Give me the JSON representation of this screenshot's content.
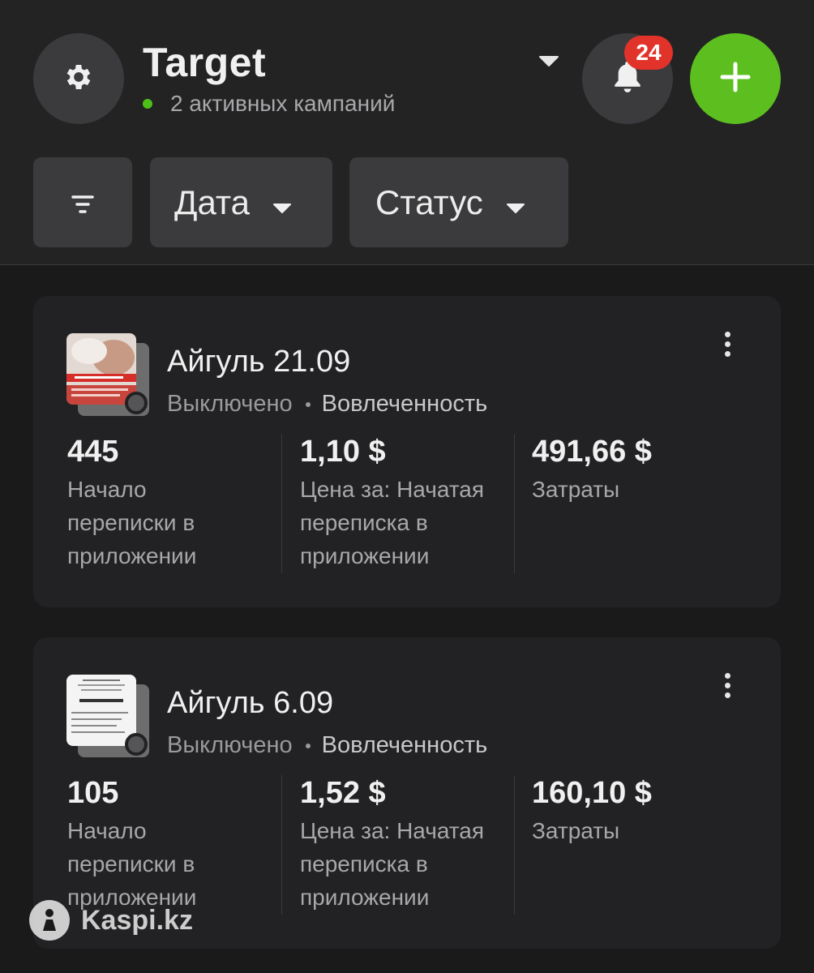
{
  "header": {
    "title": "Target",
    "subtitle": "2 активных кампаний",
    "notifications_count": "24"
  },
  "filters": {
    "date_label": "Дата",
    "status_label": "Статус"
  },
  "campaigns": [
    {
      "name": "Айгуль 21.09",
      "status": "Выключено",
      "objective": "Вовлеченность",
      "metrics": [
        {
          "value": "445",
          "label": "Начало переписки в приложении"
        },
        {
          "value": "1,10 $",
          "label": "Цена за: Начатая переписка в приложении"
        },
        {
          "value": "491,66 $",
          "label": "Затраты"
        }
      ]
    },
    {
      "name": "Айгуль 6.09",
      "status": "Выключено",
      "objective": "Вовлеченность",
      "metrics": [
        {
          "value": "105",
          "label": "Начало переписки в приложении"
        },
        {
          "value": "1,52 $",
          "label": "Цена за: Начатая переписка в приложении"
        },
        {
          "value": "160,10 $",
          "label": "Затраты"
        }
      ]
    }
  ],
  "watermark": "Kaspi.kz",
  "colors": {
    "accent_green": "#5cbf1f",
    "badge_red": "#e2332b",
    "active_dot": "#4cc218"
  },
  "icons": [
    "gear-icon",
    "bell-icon",
    "plus-icon",
    "filter-icon",
    "caret-down-icon",
    "more-vertical-icon"
  ]
}
